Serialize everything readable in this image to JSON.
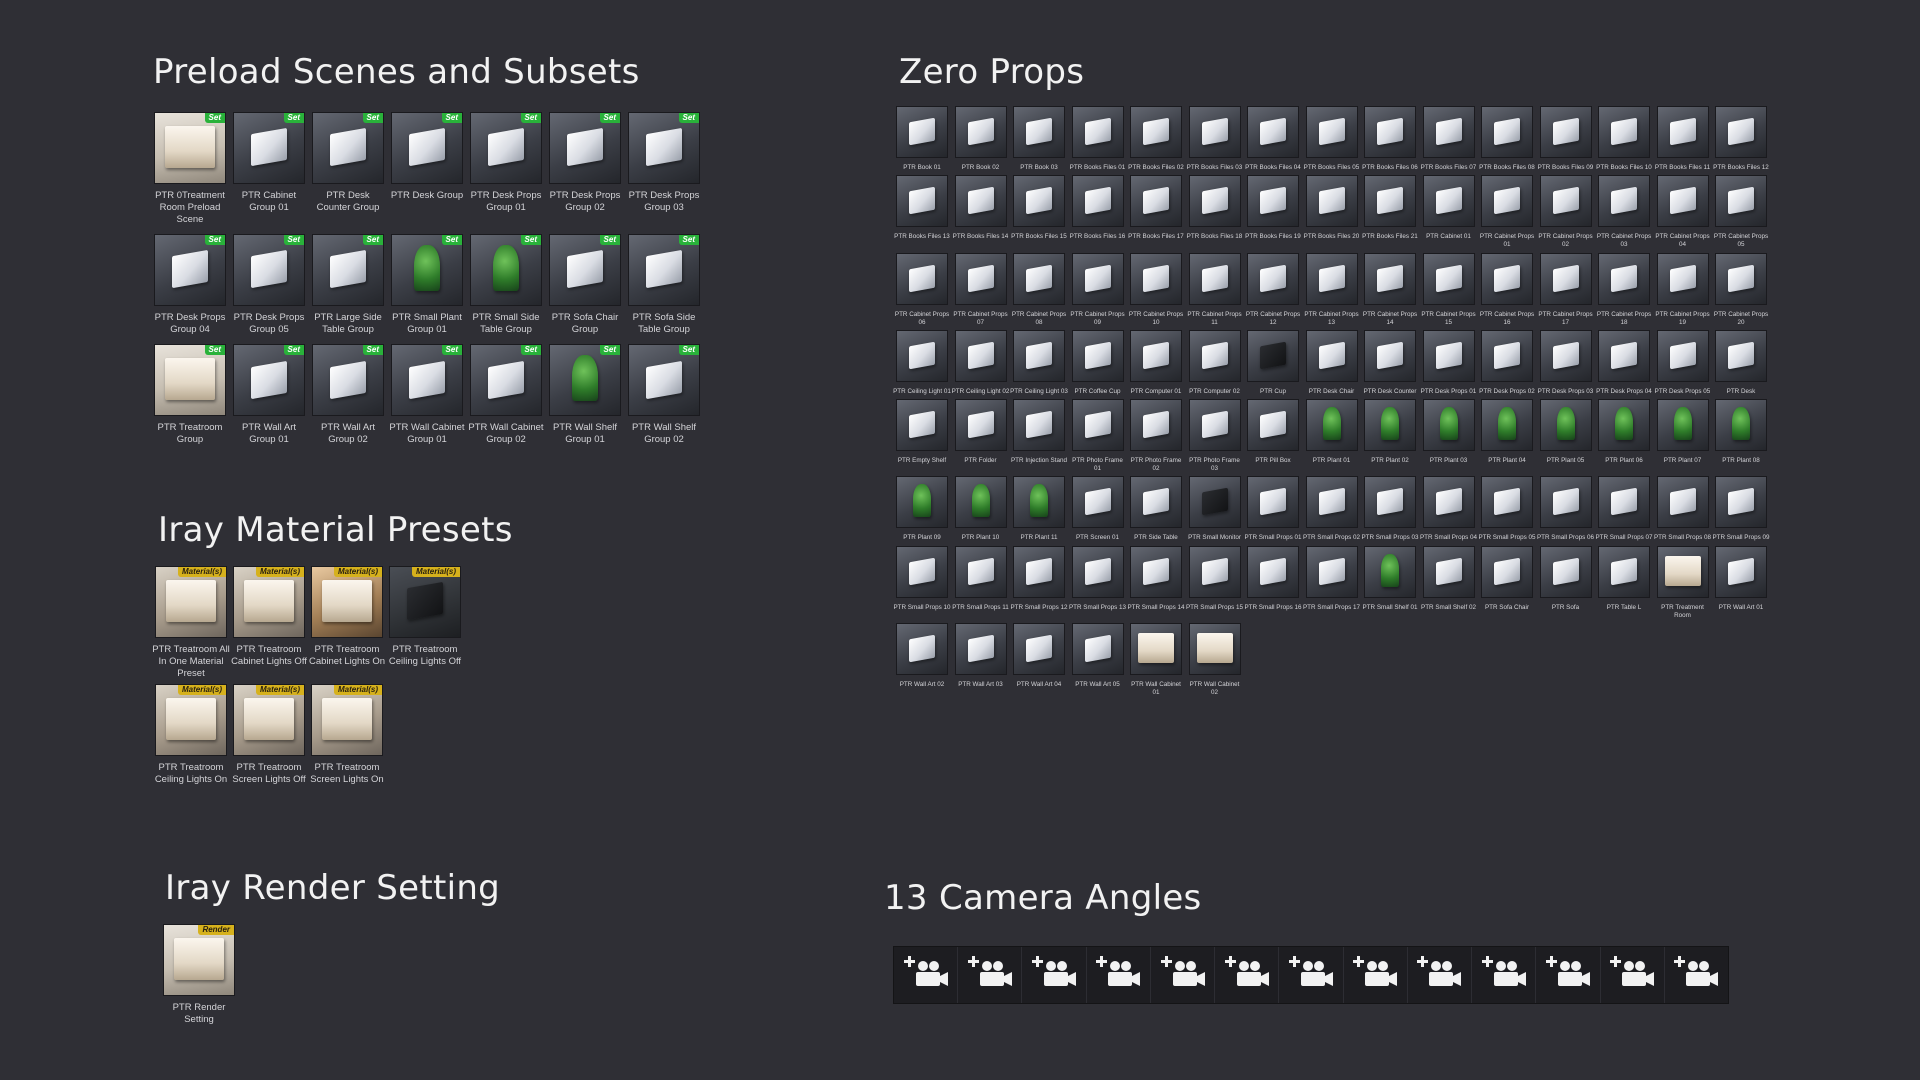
{
  "headings": {
    "subsets": "Preload Scenes and Subsets",
    "materials": "Iray Material Presets",
    "render": "Iray Render Setting",
    "props": "Zero Props",
    "cameras": "13 Camera Angles"
  },
  "badges": {
    "set": "Set",
    "material": "Material(s)",
    "render": "Render"
  },
  "subsets": [
    {
      "label": "PTR 0Treatment Room Preload Scene",
      "style": "room",
      "shape": "light"
    },
    {
      "label": "PTR Cabinet Group 01",
      "style": "default",
      "shape": "box"
    },
    {
      "label": "PTR Desk Counter Group",
      "style": "default",
      "shape": "box"
    },
    {
      "label": "PTR Desk Group",
      "style": "default",
      "shape": "box"
    },
    {
      "label": "PTR Desk Props Group 01",
      "style": "default",
      "shape": "box"
    },
    {
      "label": "PTR Desk Props Group 02",
      "style": "default",
      "shape": "box"
    },
    {
      "label": "PTR Desk Props Group 03",
      "style": "default",
      "shape": "box"
    },
    {
      "label": "PTR Desk Props Group 04",
      "style": "default",
      "shape": "box"
    },
    {
      "label": "PTR Desk Props Group 05",
      "style": "default",
      "shape": "box"
    },
    {
      "label": "PTR Large Side Table Group",
      "style": "default",
      "shape": "box"
    },
    {
      "label": "PTR Small Plant Group 01",
      "style": "default",
      "shape": "plant"
    },
    {
      "label": "PTR Small Side Table Group",
      "style": "default",
      "shape": "plant"
    },
    {
      "label": "PTR Sofa Chair Group",
      "style": "default",
      "shape": "box"
    },
    {
      "label": "PTR Sofa Side Table Group",
      "style": "default",
      "shape": "box"
    },
    {
      "label": "PTR Treatroom Group",
      "style": "room",
      "shape": "light"
    },
    {
      "label": "PTR Wall Art Group 01",
      "style": "default",
      "shape": "box"
    },
    {
      "label": "PTR Wall Art Group 02",
      "style": "default",
      "shape": "box"
    },
    {
      "label": "PTR Wall Cabinet Group 01",
      "style": "default",
      "shape": "box"
    },
    {
      "label": "PTR Wall Cabinet Group 02",
      "style": "default",
      "shape": "box"
    },
    {
      "label": "PTR Wall Shelf Group 01",
      "style": "default",
      "shape": "plant"
    },
    {
      "label": "PTR Wall Shelf Group 02",
      "style": "default",
      "shape": "box"
    }
  ],
  "materials": [
    {
      "label": "PTR Treatroom All In One Material Preset",
      "style": "light",
      "shape": "light"
    },
    {
      "label": "PTR Treatroom Cabinet Lights Off",
      "style": "light",
      "shape": "light"
    },
    {
      "label": "PTR Treatroom Cabinet Lights On",
      "style": "warm",
      "shape": "light"
    },
    {
      "label": "PTR Treatroom Ceiling Lights Off",
      "style": "dark",
      "shape": "dark"
    },
    {
      "label": "PTR Treatroom Ceiling Lights On",
      "style": "light",
      "shape": "light"
    },
    {
      "label": "PTR Treatroom Screen Lights Off",
      "style": "light",
      "shape": "light"
    },
    {
      "label": "PTR Treatroom Screen Lights On",
      "style": "light",
      "shape": "light"
    }
  ],
  "render": [
    {
      "label": "PTR Render Setting",
      "style": "room",
      "shape": "light"
    }
  ],
  "props": [
    {
      "label": "PTR Book 01",
      "shape": "box"
    },
    {
      "label": "PTR Book 02",
      "shape": "box"
    },
    {
      "label": "PTR Book 03",
      "shape": "box"
    },
    {
      "label": "PTR Books Files 01",
      "shape": "box"
    },
    {
      "label": "PTR Books Files 02",
      "shape": "box"
    },
    {
      "label": "PTR Books Files 03",
      "shape": "box"
    },
    {
      "label": "PTR Books Files 04",
      "shape": "box"
    },
    {
      "label": "PTR Books Files 05",
      "shape": "box"
    },
    {
      "label": "PTR Books Files 06",
      "shape": "box"
    },
    {
      "label": "PTR Books Files 07",
      "shape": "box"
    },
    {
      "label": "PTR Books Files 08",
      "shape": "box"
    },
    {
      "label": "PTR Books Files 09",
      "shape": "box"
    },
    {
      "label": "PTR Books Files 10",
      "shape": "box"
    },
    {
      "label": "PTR Books Files 11",
      "shape": "box"
    },
    {
      "label": "PTR Books Files 12",
      "shape": "box"
    },
    {
      "label": "PTR Books Files 13",
      "shape": "box"
    },
    {
      "label": "PTR Books Files 14",
      "shape": "box"
    },
    {
      "label": "PTR Books Files 15",
      "shape": "box"
    },
    {
      "label": "PTR Books Files 16",
      "shape": "box"
    },
    {
      "label": "PTR Books Files 17",
      "shape": "box"
    },
    {
      "label": "PTR Books Files 18",
      "shape": "box"
    },
    {
      "label": "PTR Books Files 19",
      "shape": "box"
    },
    {
      "label": "PTR Books Files 20",
      "shape": "box"
    },
    {
      "label": "PTR Books Files 21",
      "shape": "box"
    },
    {
      "label": "PTR Cabinet 01",
      "shape": "box"
    },
    {
      "label": "PTR Cabinet Props 01",
      "shape": "box"
    },
    {
      "label": "PTR Cabinet Props 02",
      "shape": "box"
    },
    {
      "label": "PTR Cabinet Props 03",
      "shape": "box"
    },
    {
      "label": "PTR Cabinet Props 04",
      "shape": "box"
    },
    {
      "label": "PTR Cabinet Props 05",
      "shape": "box"
    },
    {
      "label": "PTR Cabinet Props 06",
      "shape": "box"
    },
    {
      "label": "PTR Cabinet Props 07",
      "shape": "box"
    },
    {
      "label": "PTR Cabinet Props 08",
      "shape": "box"
    },
    {
      "label": "PTR Cabinet Props 09",
      "shape": "box"
    },
    {
      "label": "PTR Cabinet Props 10",
      "shape": "box"
    },
    {
      "label": "PTR Cabinet Props 11",
      "shape": "box"
    },
    {
      "label": "PTR Cabinet Props 12",
      "shape": "box"
    },
    {
      "label": "PTR Cabinet Props 13",
      "shape": "box"
    },
    {
      "label": "PTR Cabinet Props 14",
      "shape": "box"
    },
    {
      "label": "PTR Cabinet Props 15",
      "shape": "box"
    },
    {
      "label": "PTR Cabinet Props 16",
      "shape": "box"
    },
    {
      "label": "PTR Cabinet Props 17",
      "shape": "box"
    },
    {
      "label": "PTR Cabinet Props 18",
      "shape": "box"
    },
    {
      "label": "PTR Cabinet Props 19",
      "shape": "box"
    },
    {
      "label": "PTR Cabinet Props 20",
      "shape": "box"
    },
    {
      "label": "PTR Ceiling Light 01",
      "shape": "box"
    },
    {
      "label": "PTR Ceiling Light 02",
      "shape": "box"
    },
    {
      "label": "PTR Ceiling Light 03",
      "shape": "box"
    },
    {
      "label": "PTR Coffee Cup",
      "shape": "box"
    },
    {
      "label": "PTR Computer 01",
      "shape": "box"
    },
    {
      "label": "PTR Computer 02",
      "shape": "box"
    },
    {
      "label": "PTR Cup",
      "shape": "dark"
    },
    {
      "label": "PTR Desk Chair",
      "shape": "box"
    },
    {
      "label": "PTR Desk Counter",
      "shape": "box"
    },
    {
      "label": "PTR Desk Props 01",
      "shape": "box"
    },
    {
      "label": "PTR Desk Props 02",
      "shape": "box"
    },
    {
      "label": "PTR Desk Props 03",
      "shape": "box"
    },
    {
      "label": "PTR Desk Props 04",
      "shape": "box"
    },
    {
      "label": "PTR Desk Props 05",
      "shape": "box"
    },
    {
      "label": "PTR Desk",
      "shape": "box"
    },
    {
      "label": "PTR Empty Shelf",
      "shape": "box"
    },
    {
      "label": "PTR Folder",
      "shape": "box"
    },
    {
      "label": "PTR Injection Stand",
      "shape": "box"
    },
    {
      "label": "PTR Photo Frame 01",
      "shape": "box"
    },
    {
      "label": "PTR Photo Frame 02",
      "shape": "box"
    },
    {
      "label": "PTR Photo Frame 03",
      "shape": "box"
    },
    {
      "label": "PTR Pill Box",
      "shape": "box"
    },
    {
      "label": "PTR Plant 01",
      "shape": "plant"
    },
    {
      "label": "PTR Plant 02",
      "shape": "plant"
    },
    {
      "label": "PTR Plant 03",
      "shape": "plant"
    },
    {
      "label": "PTR Plant 04",
      "shape": "plant"
    },
    {
      "label": "PTR Plant 05",
      "shape": "plant"
    },
    {
      "label": "PTR Plant 06",
      "shape": "plant"
    },
    {
      "label": "PTR Plant 07",
      "shape": "plant"
    },
    {
      "label": "PTR Plant 08",
      "shape": "plant"
    },
    {
      "label": "PTR Plant 09",
      "shape": "plant"
    },
    {
      "label": "PTR Plant 10",
      "shape": "plant"
    },
    {
      "label": "PTR Plant 11",
      "shape": "plant"
    },
    {
      "label": "PTR Screen 01",
      "shape": "box"
    },
    {
      "label": "PTR Side Table",
      "shape": "box"
    },
    {
      "label": "PTR Small Monitor",
      "shape": "dark"
    },
    {
      "label": "PTR Small Props 01",
      "shape": "box"
    },
    {
      "label": "PTR Small Props 02",
      "shape": "box"
    },
    {
      "label": "PTR Small Props 03",
      "shape": "box"
    },
    {
      "label": "PTR Small Props 04",
      "shape": "box"
    },
    {
      "label": "PTR Small Props 05",
      "shape": "box"
    },
    {
      "label": "PTR Small Props 06",
      "shape": "box"
    },
    {
      "label": "PTR Small Props 07",
      "shape": "box"
    },
    {
      "label": "PTR Small Props 08",
      "shape": "box"
    },
    {
      "label": "PTR Small Props 09",
      "shape": "box"
    },
    {
      "label": "PTR Small Props 10",
      "shape": "box"
    },
    {
      "label": "PTR Small Props 11",
      "shape": "box"
    },
    {
      "label": "PTR Small Props 12",
      "shape": "box"
    },
    {
      "label": "PTR Small Props 13",
      "shape": "box"
    },
    {
      "label": "PTR Small Props 14",
      "shape": "box"
    },
    {
      "label": "PTR Small Props 15",
      "shape": "box"
    },
    {
      "label": "PTR Small Props 16",
      "shape": "box"
    },
    {
      "label": "PTR Small Props 17",
      "shape": "box"
    },
    {
      "label": "PTR Small Shelf 01",
      "shape": "plant"
    },
    {
      "label": "PTR Small Shelf 02",
      "shape": "box"
    },
    {
      "label": "PTR Sofa Chair",
      "shape": "box"
    },
    {
      "label": "PTR Sofa",
      "shape": "box"
    },
    {
      "label": "PTR Table L",
      "shape": "box"
    },
    {
      "label": "PTR Treatment Room",
      "shape": "light"
    },
    {
      "label": "PTR Wall Art 01",
      "shape": "box"
    },
    {
      "label": "PTR Wall Art 02",
      "shape": "box"
    },
    {
      "label": "PTR Wall Art 03",
      "shape": "box"
    },
    {
      "label": "PTR Wall Art 04",
      "shape": "box"
    },
    {
      "label": "PTR Wall Art 05",
      "shape": "box"
    },
    {
      "label": "PTR Wall Cabinet 01",
      "shape": "light"
    },
    {
      "label": "PTR Wall Cabinet 02",
      "shape": "light"
    }
  ],
  "cameras": {
    "count": 13,
    "icon": "camera-plus-icon"
  }
}
